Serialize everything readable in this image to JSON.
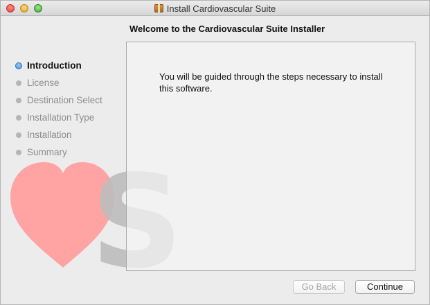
{
  "window": {
    "title": "Install Cardiovascular Suite"
  },
  "header": {
    "heading": "Welcome to the Cardiovascular Suite  Installer"
  },
  "sidebar": {
    "steps": [
      {
        "label": "Introduction",
        "active": true
      },
      {
        "label": "License",
        "active": false
      },
      {
        "label": "Destination Select",
        "active": false
      },
      {
        "label": "Installation Type",
        "active": false
      },
      {
        "label": "Installation",
        "active": false
      },
      {
        "label": "Summary",
        "active": false
      }
    ]
  },
  "content": {
    "message": "You will be guided through the steps necessary to install this software."
  },
  "buttons": {
    "back_label": "Go Back",
    "continue_label": "Continue"
  },
  "colors": {
    "heart": "#ffa3a3",
    "logo_letter": "#c4c4c4",
    "active_step": "#3a86d6"
  },
  "icons": {
    "window_icon": "package-icon",
    "logo": "heart-s-logo"
  }
}
